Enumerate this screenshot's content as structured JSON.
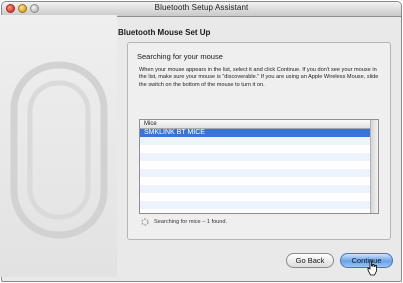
{
  "window": {
    "title": "Bluetooth Setup Assistant"
  },
  "heading": "Bluetooth Mouse Set Up",
  "section": {
    "title": "Searching for your mouse",
    "instructions": "When your mouse appears in the list, select it and click Continue. If you don't see your mouse in the list, make sure your mouse is \"discoverable.\" If you are using an Apple Wireless Mouse, slide the switch on the bottom of the mouse to turn it on."
  },
  "list": {
    "header": "Mice",
    "items": [
      "SMKLINK BT MICE"
    ]
  },
  "status": "Searching for mice – 1 found.",
  "buttons": {
    "back": "Go Back",
    "continue": "Continue"
  }
}
